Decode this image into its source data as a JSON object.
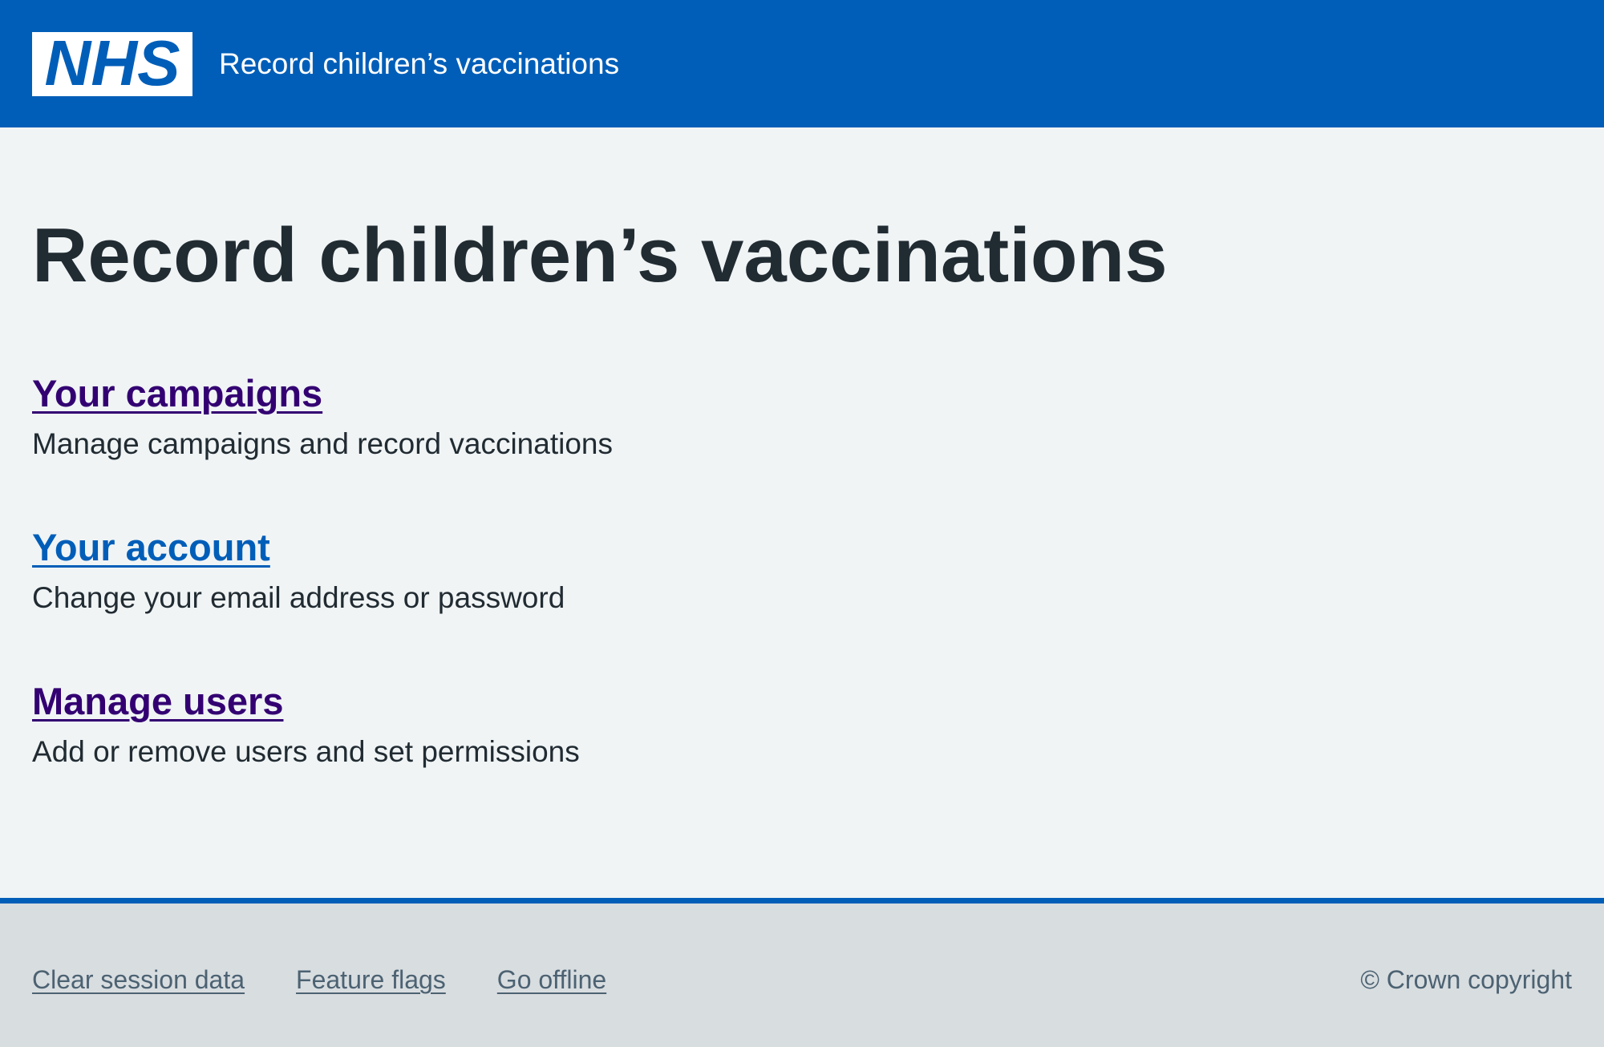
{
  "header": {
    "logo_text": "NHS",
    "service_name": "Record children’s vaccinations",
    "background_color": "#005eb8"
  },
  "main": {
    "title": "Record children’s vaccinations",
    "items": [
      {
        "link_label": "Your campaigns",
        "description": "Manage campaigns and record vaccinations",
        "link_color": "#330072"
      },
      {
        "link_label": "Your account",
        "description": "Change your email address or password",
        "link_color": "#005eb8"
      },
      {
        "link_label": "Manage users",
        "description": "Add or remove users and set permissions",
        "link_color": "#330072"
      }
    ]
  },
  "footer": {
    "links": [
      "Clear session data",
      "Feature flags",
      "Go offline"
    ],
    "copyright": "© Crown copyright"
  }
}
